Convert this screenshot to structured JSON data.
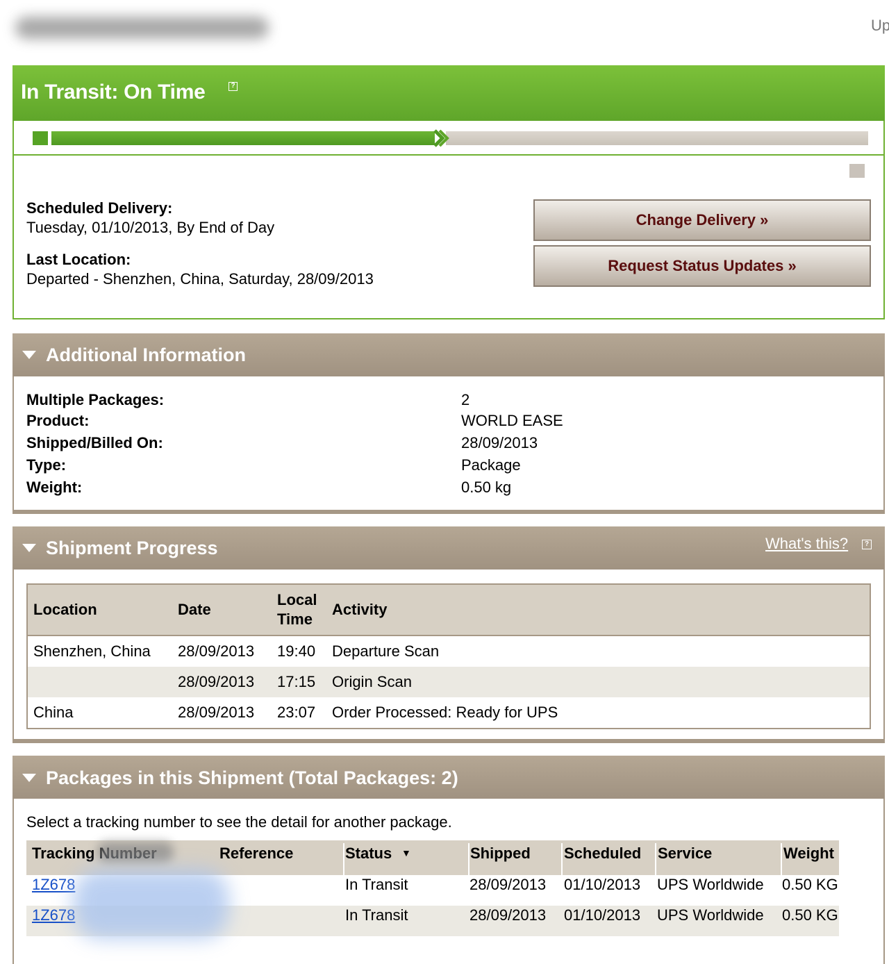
{
  "header": {
    "top_right_text": "Up"
  },
  "status": {
    "title": "In Transit: On Time",
    "help_glyph": "?",
    "progress_fraction": 0.47,
    "scheduled_delivery_label": "Scheduled Delivery:",
    "scheduled_delivery_value": "Tuesday, 01/10/2013, By End of Day",
    "last_location_label": "Last Location:",
    "last_location_value": "Departed - Shenzhen, China, Saturday, 28/09/2013",
    "change_delivery_label": "Change Delivery »",
    "request_updates_label": "Request Status Updates »"
  },
  "additional": {
    "title": "Additional Information",
    "rows": [
      {
        "label": "Multiple Packages:",
        "value": "2"
      },
      {
        "label": "Product:",
        "value": "WORLD EASE"
      },
      {
        "label": "Shipped/Billed On:",
        "value": "28/09/2013"
      },
      {
        "label": "Type:",
        "value": "Package"
      },
      {
        "label": "Weight:",
        "value": "0.50 kg"
      }
    ]
  },
  "progress": {
    "title": "Shipment Progress",
    "whats_this": "What's this?",
    "columns": {
      "location": "Location",
      "date": "Date",
      "local_time_1": "Local",
      "local_time_2": "Time",
      "activity": "Activity"
    },
    "rows": [
      {
        "location": "Shenzhen, China",
        "date": "28/09/2013",
        "time": "19:40",
        "activity": "Departure Scan"
      },
      {
        "location": "",
        "date": "28/09/2013",
        "time": "17:15",
        "activity": "Origin Scan"
      },
      {
        "location": "China",
        "date": "28/09/2013",
        "time": "23:07",
        "activity": "Order Processed: Ready for UPS"
      }
    ]
  },
  "packages": {
    "title": "Packages in this Shipment (Total Packages: 2)",
    "instruction": "Select a tracking number to see the detail for another package.",
    "columns": {
      "tracking": "Tracking Number",
      "reference": "Reference",
      "status": "Status",
      "status_sort": "▼",
      "shipped": "Shipped",
      "scheduled": "Scheduled",
      "service": "Service",
      "weight": "Weight"
    },
    "rows": [
      {
        "tracking": "1Z678",
        "status": "In Transit",
        "shipped": "28/09/2013",
        "scheduled": "01/10/2013",
        "service": "UPS Worldwide",
        "weight": "0.50 KG"
      },
      {
        "tracking": "1Z678",
        "status": "In Transit",
        "shipped": "28/09/2013",
        "scheduled": "01/10/2013",
        "service": "UPS Worldwide",
        "weight": "0.50 KG"
      }
    ]
  }
}
